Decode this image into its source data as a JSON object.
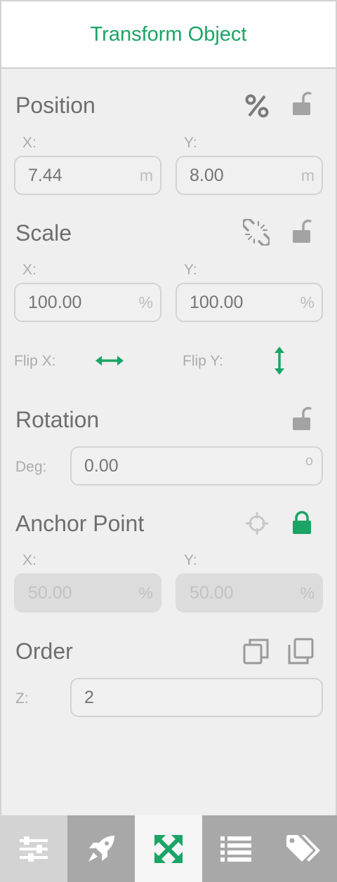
{
  "header": {
    "title": "Transform Object"
  },
  "position": {
    "title": "Position",
    "percent_icon": "percent-icon",
    "lock_icon": "unlock-icon",
    "x_label": "X:",
    "y_label": "Y:",
    "x_value": "7.44",
    "y_value": "8.00",
    "unit": "m"
  },
  "scale": {
    "title": "Scale",
    "link_icon": "unlink-icon",
    "lock_icon": "unlock-icon",
    "x_label": "X:",
    "y_label": "Y:",
    "x_value": "100.00",
    "y_value": "100.00",
    "unit": "%",
    "flip_x_label": "Flip X:",
    "flip_y_label": "Flip Y:"
  },
  "rotation": {
    "title": "Rotation",
    "lock_icon": "unlock-icon",
    "deg_label": "Deg:",
    "value": "0.00",
    "unit": "o"
  },
  "anchor": {
    "title": "Anchor Point",
    "crosshair_icon": "crosshair-icon",
    "lock_icon": "lock-icon",
    "x_label": "X:",
    "y_label": "Y:",
    "x_value": "50.00",
    "y_value": "50.00",
    "unit": "%"
  },
  "order": {
    "title": "Order",
    "z_label": "Z:",
    "value": "2"
  },
  "tabs": [
    {
      "name": "sliders-icon",
      "active": false
    },
    {
      "name": "rocket-icon",
      "active": false
    },
    {
      "name": "transform-icon",
      "active": true
    },
    {
      "name": "list-icon",
      "active": false
    },
    {
      "name": "tags-icon",
      "active": false
    }
  ],
  "colors": {
    "accent": "#1aa466",
    "text": "#6e6e6e",
    "label": "#ababab",
    "tab_bg": "#a8a8a8"
  }
}
